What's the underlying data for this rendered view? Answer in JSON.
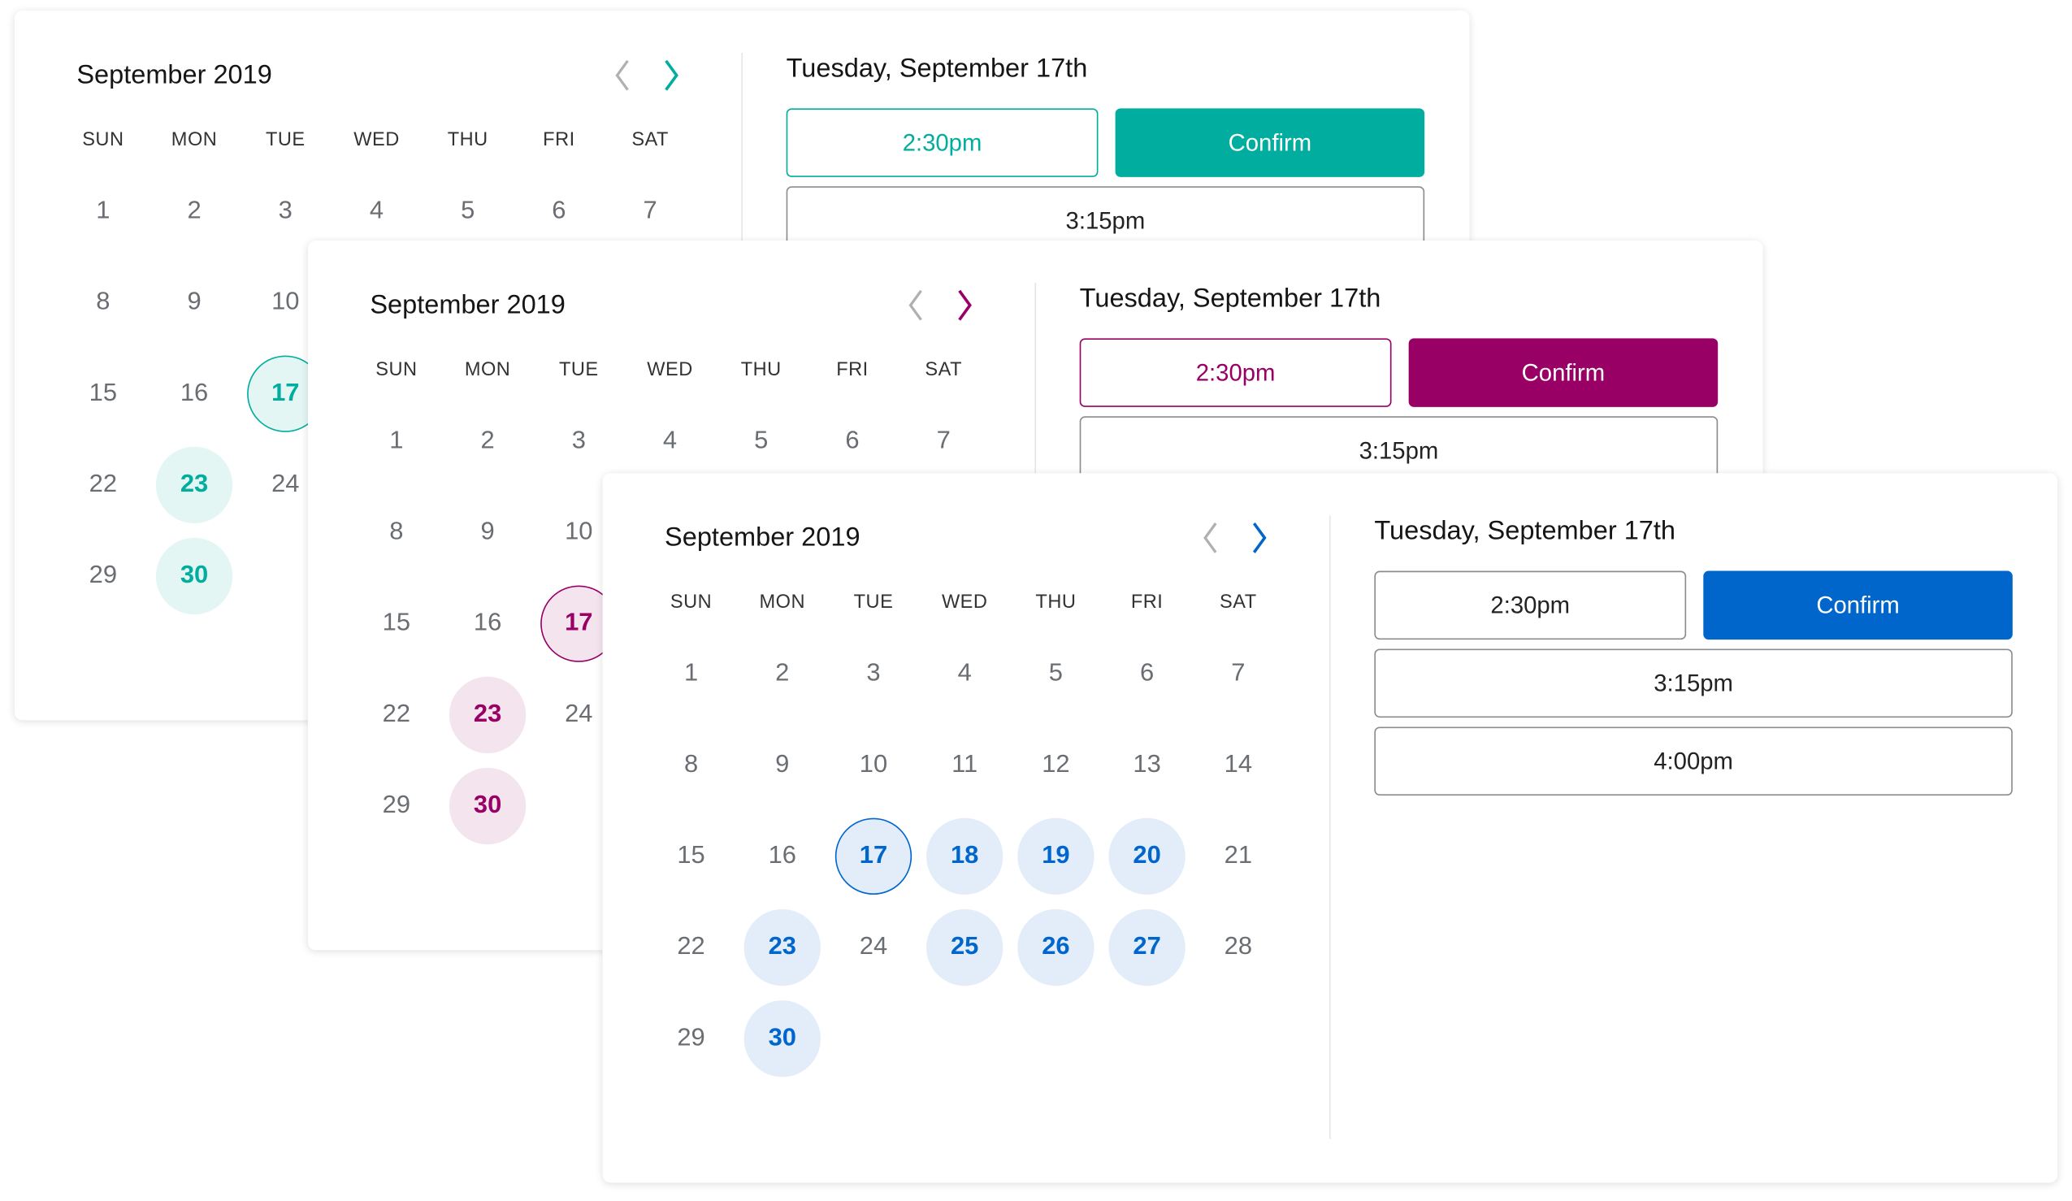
{
  "calendar": {
    "month_label": "September 2019",
    "weekdays": [
      "SUN",
      "MON",
      "TUE",
      "WED",
      "THU",
      "FRI",
      "SAT"
    ],
    "weeks": [
      [
        1,
        2,
        3,
        4,
        5,
        6,
        7
      ],
      [
        8,
        9,
        10,
        11,
        12,
        13,
        14
      ],
      [
        15,
        16,
        17,
        18,
        19,
        20,
        21
      ],
      [
        22,
        23,
        24,
        25,
        26,
        27,
        28
      ],
      [
        29,
        30
      ]
    ],
    "selected_day": 17,
    "available_days": [
      17,
      18,
      19,
      20,
      23,
      25,
      26,
      27,
      30
    ],
    "nav_prev_icon": "chevron-left-icon",
    "nav_next_icon": "chevron-right-icon"
  },
  "date_panel": {
    "title": "Tuesday, September 17th",
    "confirm_label": "Confirm",
    "time_slots": [
      "2:30pm",
      "3:15pm",
      "4:00pm"
    ]
  },
  "cards": [
    {
      "theme": "teal",
      "accent": "#00ad9f",
      "light": "#e4f6f4",
      "slot_selected": true
    },
    {
      "theme": "magenta",
      "accent": "#990066",
      "light": "#f4e4ee",
      "slot_selected": true
    },
    {
      "theme": "blue",
      "accent": "#0066cc",
      "light": "#e3edfa",
      "slot_selected": false
    }
  ]
}
